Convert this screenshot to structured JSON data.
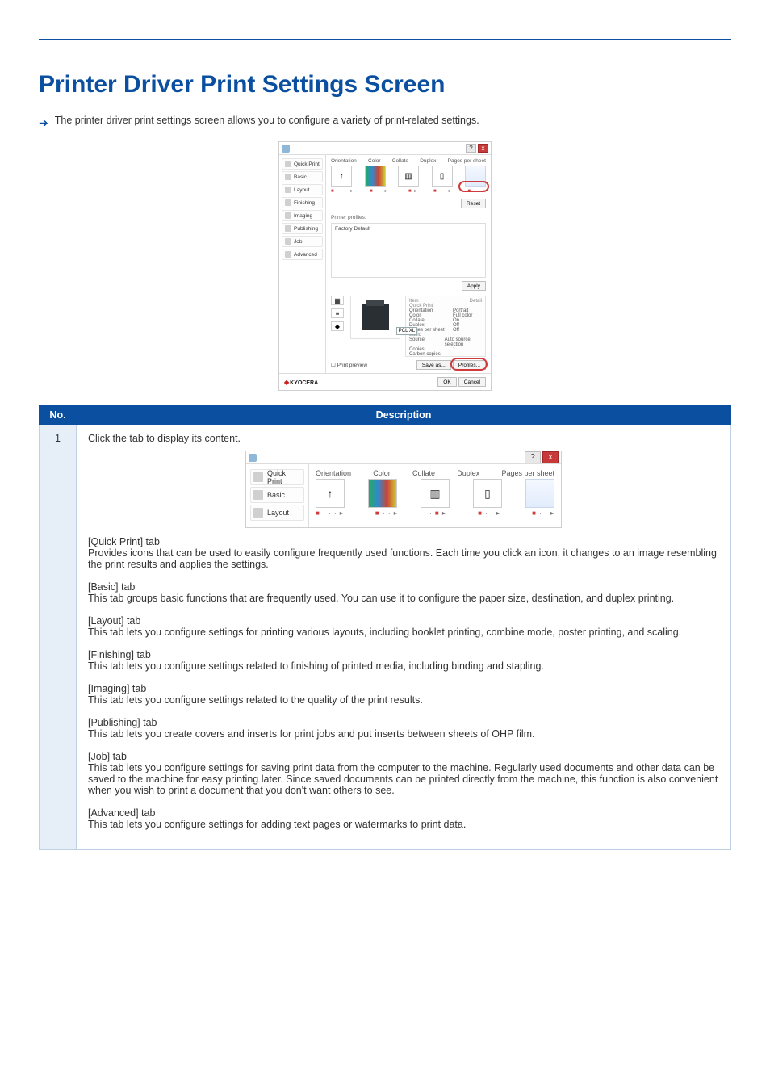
{
  "heading": "Printer Driver Print Settings Screen",
  "lead": "The printer driver print settings screen allows you to configure a variety of print-related settings.",
  "figure1": {
    "tabs": [
      "Quick Print",
      "Basic",
      "Layout",
      "Finishing",
      "Imaging",
      "Publishing",
      "Job",
      "Advanced"
    ],
    "opts": [
      "Orientation",
      "Color",
      "Collate",
      "Duplex",
      "Pages per sheet"
    ],
    "profiles_label": "Printer profiles:",
    "profile_item": "Factory Default",
    "apply": "Apply",
    "pcl": "PCL XL",
    "print_preview": "Print preview",
    "save_as": "Save as...",
    "profiles_btn": "Profiles...",
    "ok": "OK",
    "cancel": "Cancel",
    "brand": "KYOCERA",
    "help": "?",
    "close": "x",
    "summary": {
      "head_item": "Item",
      "head_detail": "Detail",
      "group1": "Quick Print",
      "rows1": [
        [
          "Orientation",
          "Portrait"
        ],
        [
          "Color",
          "Full color"
        ],
        [
          "Collate",
          "On"
        ],
        [
          "Duplex",
          "Off"
        ],
        [
          "Pages per sheet",
          "Off"
        ]
      ],
      "group2": "Basic",
      "rows2": [
        [
          "Source",
          "Auto source selection"
        ],
        [
          "Copies",
          "1"
        ],
        [
          "Carbon copies",
          ""
        ]
      ]
    }
  },
  "table": {
    "head_no": "No.",
    "head_desc": "Description",
    "row1": {
      "no": "1",
      "para": "Click the tab to display its content.",
      "fig_tabs": [
        "Quick Print",
        "Basic",
        "Layout"
      ],
      "opts": [
        "Orientation",
        "Color",
        "Collate",
        "Duplex",
        "Pages per sheet"
      ],
      "help": "?",
      "close": "x",
      "tabs": [
        {
          "title": "[Quick Print] tab",
          "desc": "Provides icons that can be used to easily configure frequently used functions. Each time you click an icon, it changes to an image resembling the print results and applies the settings."
        },
        {
          "title": "[Basic] tab",
          "desc": "This tab groups basic functions that are frequently used. You can use it to configure the paper size, destination, and duplex printing."
        },
        {
          "title": "[Layout] tab",
          "desc": "This tab lets you configure settings for printing various layouts, including booklet printing, combine mode, poster printing, and scaling."
        },
        {
          "title": "[Finishing] tab",
          "desc": "This tab lets you configure settings related to finishing of printed media, including binding and stapling."
        },
        {
          "title": "[Imaging] tab",
          "desc": "This tab lets you configure settings related to the quality of the print results."
        },
        {
          "title": "[Publishing] tab",
          "desc": "This tab lets you create covers and inserts for print jobs and put inserts between sheets of OHP film."
        },
        {
          "title": "[Job] tab",
          "desc": "This tab lets you configure settings for saving print data from the computer to the machine. Regularly used documents and other data can be saved to the machine for easy printing later. Since saved documents can be printed directly from the machine, this function is also convenient when you wish to print a document that you don't want others to see."
        },
        {
          "title": "[Advanced] tab",
          "desc": "This tab lets you configure settings for adding text pages or watermarks to print data."
        }
      ]
    }
  }
}
